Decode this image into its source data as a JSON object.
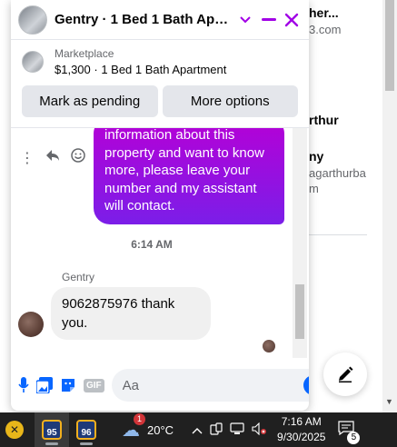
{
  "background_page": {
    "snippets": [
      {
        "text": "her...",
        "sub": "3.com"
      },
      {
        "text": "rthur",
        "sub": ""
      },
      {
        "text": "ny",
        "sub": "agarthurba"
      },
      {
        "text": "",
        "sub": "m"
      }
    ]
  },
  "chat": {
    "title": "Gentry · 1 Bed 1 Bath Apar...",
    "listing": {
      "label": "Marketplace",
      "description": "$1,300 · 1 Bed 1 Bath Apartment"
    },
    "actions": {
      "mark_pending": "Mark as pending",
      "more_options": "More options"
    },
    "outgoing_message": "information about this property and want to know more, please leave your number and my assistant will contact.",
    "timestamp": "6:14 AM",
    "sender_name": "Gentry",
    "incoming_message": "9062875976 thank you.",
    "composer": {
      "placeholder": "Aa",
      "gif_label": "GIF"
    }
  },
  "taskbar": {
    "app1_label": "95",
    "app2_label": "96",
    "weather_temp": "20°C",
    "weather_badge": "1",
    "time": "7:16 AM",
    "date": "9/30/2025",
    "notification_count": "5"
  },
  "colors": {
    "accent": "#a100e6",
    "messenger_blue": "#0866ff",
    "bubble_gradient_top": "#b600d6",
    "bubble_gradient_bottom": "#7b1ee8"
  },
  "icons": [
    "minimize-icon",
    "close-icon",
    "chevron-down-icon",
    "mic-icon",
    "photo-icon",
    "sticker-icon",
    "gif-icon",
    "emoji-icon",
    "like-icon",
    "more-icon",
    "reply-icon",
    "react-icon",
    "compose-icon"
  ]
}
